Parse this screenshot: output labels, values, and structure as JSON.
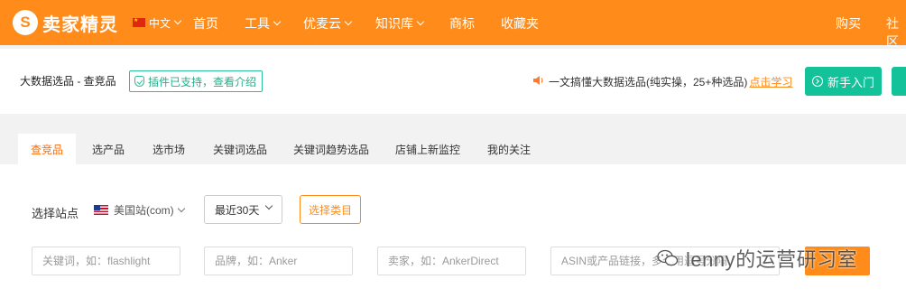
{
  "topnav": {
    "logo_glyph": "S",
    "logo_text": "卖家精灵",
    "lang": "中文",
    "items": [
      {
        "label": "首页"
      },
      {
        "label": "工具",
        "dropdown": true
      },
      {
        "label": "优麦云",
        "dropdown": true
      },
      {
        "label": "知识库",
        "dropdown": true
      },
      {
        "label": "商标"
      },
      {
        "label": "收藏夹"
      }
    ],
    "right_items": [
      {
        "label": "购买"
      },
      {
        "label": "社区"
      }
    ],
    "accent": "#ff8c1a"
  },
  "header": {
    "breadcrumb": "大数据选品 - 查竞品",
    "plugin_badge": "插件已支持，查看介绍",
    "notice_text": "一文搞懂大数据选品(纯实操，25+种选品)",
    "notice_link": "点击学习",
    "primary_button": "新手入门",
    "button_color": "#14c29a"
  },
  "tabs": [
    {
      "label": "查竞品",
      "active": true
    },
    {
      "label": "选产品"
    },
    {
      "label": "选市场"
    },
    {
      "label": "关键词选品"
    },
    {
      "label": "关键词趋势选品"
    },
    {
      "label": "店铺上新监控"
    },
    {
      "label": "我的关注"
    }
  ],
  "filters": {
    "site_label": "选择站点",
    "site_value": "美国站(com)",
    "date_value": "最近30天",
    "category_button": "选择类目",
    "keyword_placeholder": "关键词，如：flashlight",
    "brand_placeholder": "品牌，如：Anker",
    "seller_placeholder": "卖家，如：AnkerDirect",
    "asin_placeholder": "ASIN或产品链接，多个用逗号分隔"
  },
  "watermark": {
    "text": "lenny的运营研习室"
  }
}
